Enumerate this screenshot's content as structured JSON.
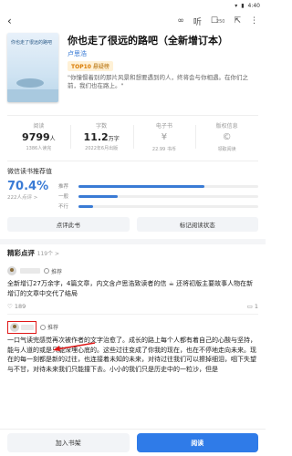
{
  "status_bar": {
    "time": "4:40"
  },
  "top_bar": {
    "back_icon": "chevron-left-icon",
    "listen_label": "听",
    "badge": "250"
  },
  "book": {
    "title": "你也走了很远的路吧（全新增订本）",
    "author": "卢思浩",
    "tag_number": "TOP10",
    "tag_text": "悬疑榜",
    "quote": "\"你憧憬着别的那片风景和想要遇到的人，终将会与你相遇。在你们之前，我们也在路上。\"",
    "cover_title": "你也走了很远的路吧"
  },
  "stats": [
    {
      "label": "阅读",
      "value": "9799",
      "unit": "人",
      "sub": "1386人读完"
    },
    {
      "label": "字数",
      "value": "11.2",
      "unit": "万字",
      "sub": "2022年6月出版"
    },
    {
      "label": "电子书",
      "value": "¥",
      "unit": "",
      "sub": "22.99 书币"
    },
    {
      "label": "版权信息",
      "value": "",
      "unit": "",
      "sub": "领取阅读"
    }
  ],
  "rating": {
    "header": "微信读书推荐值",
    "percent": "70.4%",
    "count": "222人点评 >",
    "bars": [
      {
        "label": "推荐",
        "fraction": 0.7
      },
      {
        "label": "一般",
        "fraction": 0.22
      },
      {
        "label": "不行",
        "fraction": 0.08
      }
    ],
    "buttons": [
      "点评此书",
      "标记阅读状态"
    ]
  },
  "reviews": {
    "header": "精彩点评",
    "count": "119个 >",
    "items": [
      {
        "rec_label": "推荐",
        "text": "全新增订27万余字，4篇文章，内文含卢思浩致读者的信 ☕ 还将初版主要故事人物在新增订的文章中交代了结局",
        "likes": "189",
        "comments": "1"
      },
      {
        "rec_label": "推荐",
        "text": "一口气读完感觉再次被作者的文字治愈了。成长的路上每个人都有着自己的心酸与坚持，能与人道的或是只能深埋心底的。这些过往变成了你我的现在，也在不停地走向未来。现在的每一刻都是新的过往，也连接着未知的未来，对待过往我们可以擦掉细泪，咽下失望与不甘，对待未来我们只能撞下去。小小的我们只是历史中的一粒沙，但是"
      }
    ]
  },
  "bottom_bar": {
    "add_shelf": "加入书架",
    "read": "阅读"
  }
}
